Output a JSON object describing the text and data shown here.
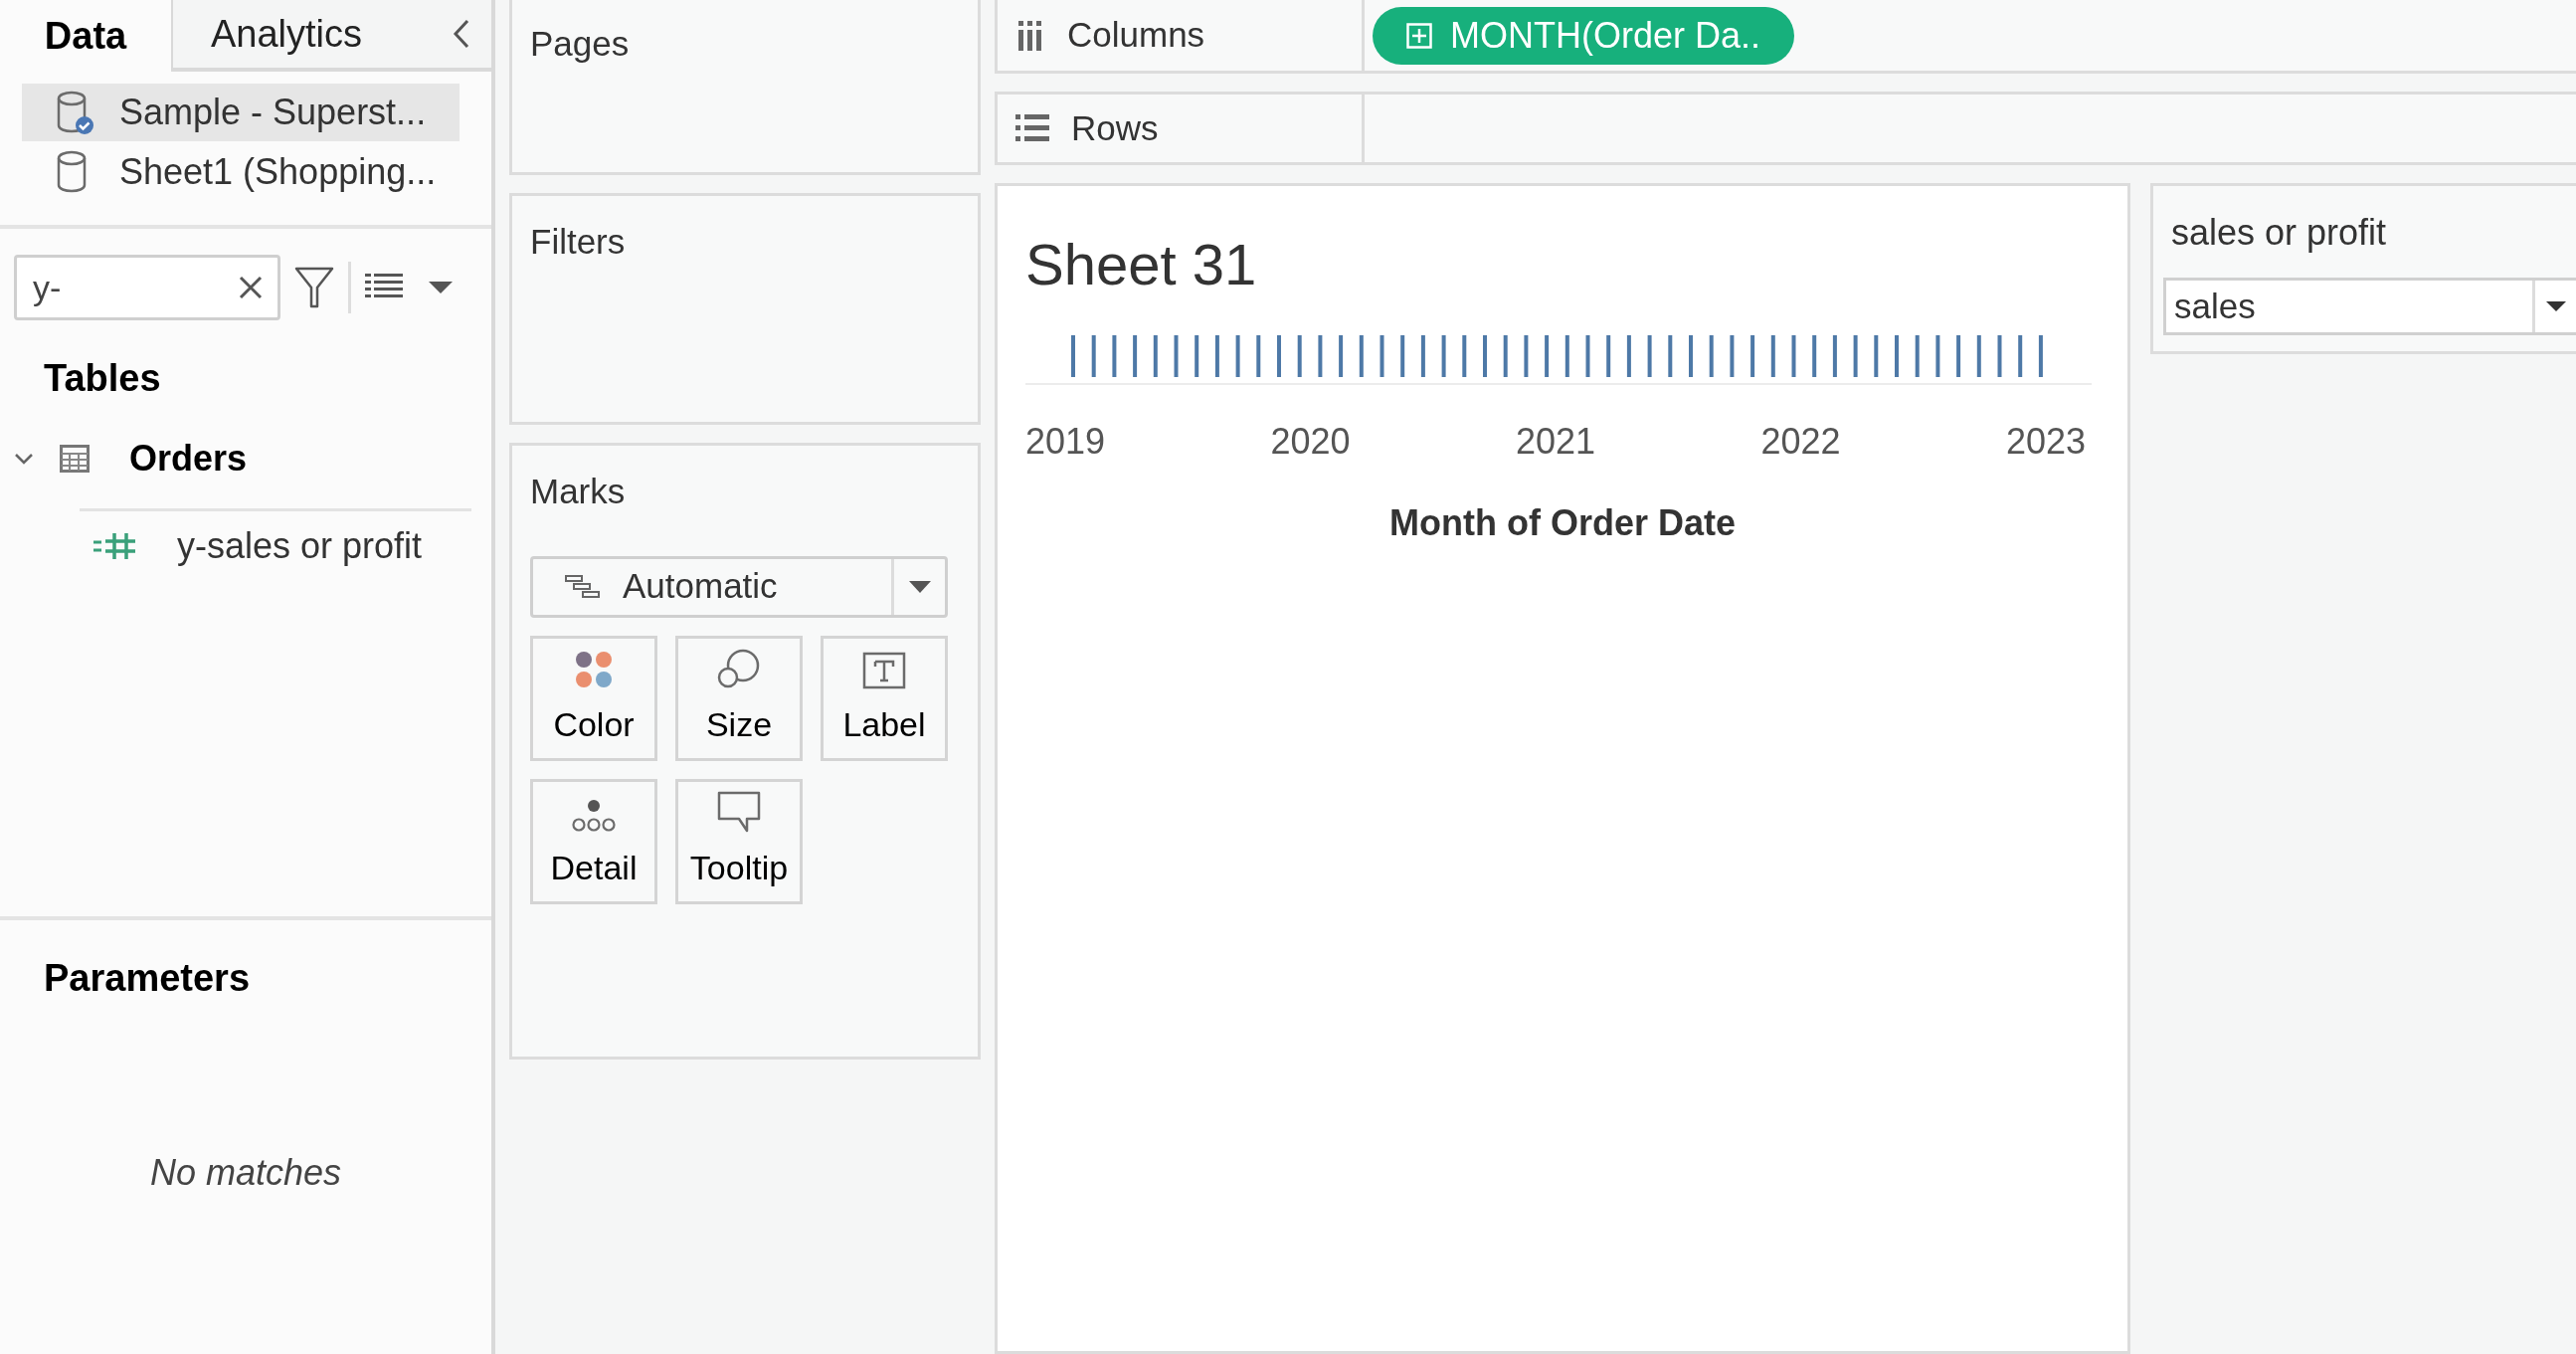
{
  "sidebar": {
    "tabs": [
      {
        "label": "Data",
        "selected": true
      },
      {
        "label": "Analytics",
        "selected": false
      }
    ],
    "data_sources": [
      {
        "name": "Sample - Superst...",
        "selected": true,
        "connected": true
      },
      {
        "name": "Sheet1 (Shopping...",
        "selected": false,
        "connected": false
      }
    ],
    "search": {
      "value": "y-"
    },
    "tables_heading": "Tables",
    "tables": [
      {
        "name": "Orders",
        "expanded": true,
        "children": [
          {
            "name": "y-sales or profit",
            "kind": "measure"
          }
        ]
      }
    ],
    "parameters_heading": "Parameters",
    "parameters_empty": "No matches"
  },
  "cards": {
    "pages": "Pages",
    "filters": "Filters",
    "marks": {
      "title": "Marks",
      "type": "Automatic",
      "buttons": [
        {
          "label": "Color",
          "kind": "color"
        },
        {
          "label": "Size",
          "kind": "size"
        },
        {
          "label": "Label",
          "kind": "label"
        },
        {
          "label": "Detail",
          "kind": "detail"
        },
        {
          "label": "Tooltip",
          "kind": "tooltip"
        }
      ]
    }
  },
  "shelves": [
    {
      "label": "Columns",
      "kind": "columns",
      "pills": [
        "MONTH(Order Da.."
      ]
    },
    {
      "label": "Rows",
      "kind": "rows"
    }
  ],
  "sheet": {
    "title": "Sheet 31",
    "axis_labels": [
      "2019",
      "2020",
      "2021",
      "2022",
      "2023"
    ],
    "axis_title": "Month of Order Date"
  },
  "parameter_card": {
    "title": "sales or profit",
    "value": "sales"
  }
}
